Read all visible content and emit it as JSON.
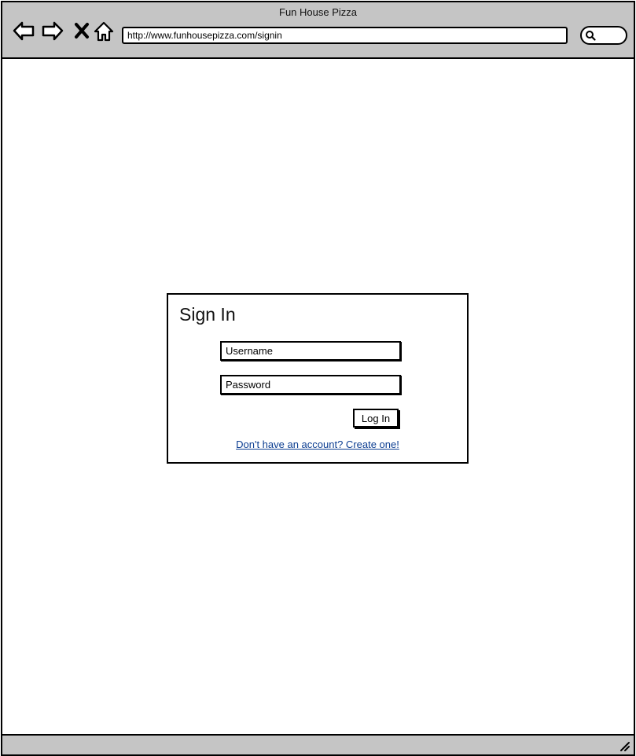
{
  "window": {
    "title": "Fun House Pizza"
  },
  "toolbar": {
    "back_icon": "back-arrow-icon",
    "forward_icon": "forward-arrow-icon",
    "stop_icon": "close-icon",
    "home_icon": "home-icon",
    "url": "http://www.funhousepizza.com/signin",
    "search_icon": "search-icon"
  },
  "signin": {
    "title": "Sign In",
    "username_placeholder": "Username",
    "password_placeholder": "Password",
    "login_label": "Log In",
    "signup_link": "Don't have an account? Create one!"
  },
  "colors": {
    "chrome": "#c5c5c5",
    "border": "#000000",
    "link": "#0b3d91"
  }
}
